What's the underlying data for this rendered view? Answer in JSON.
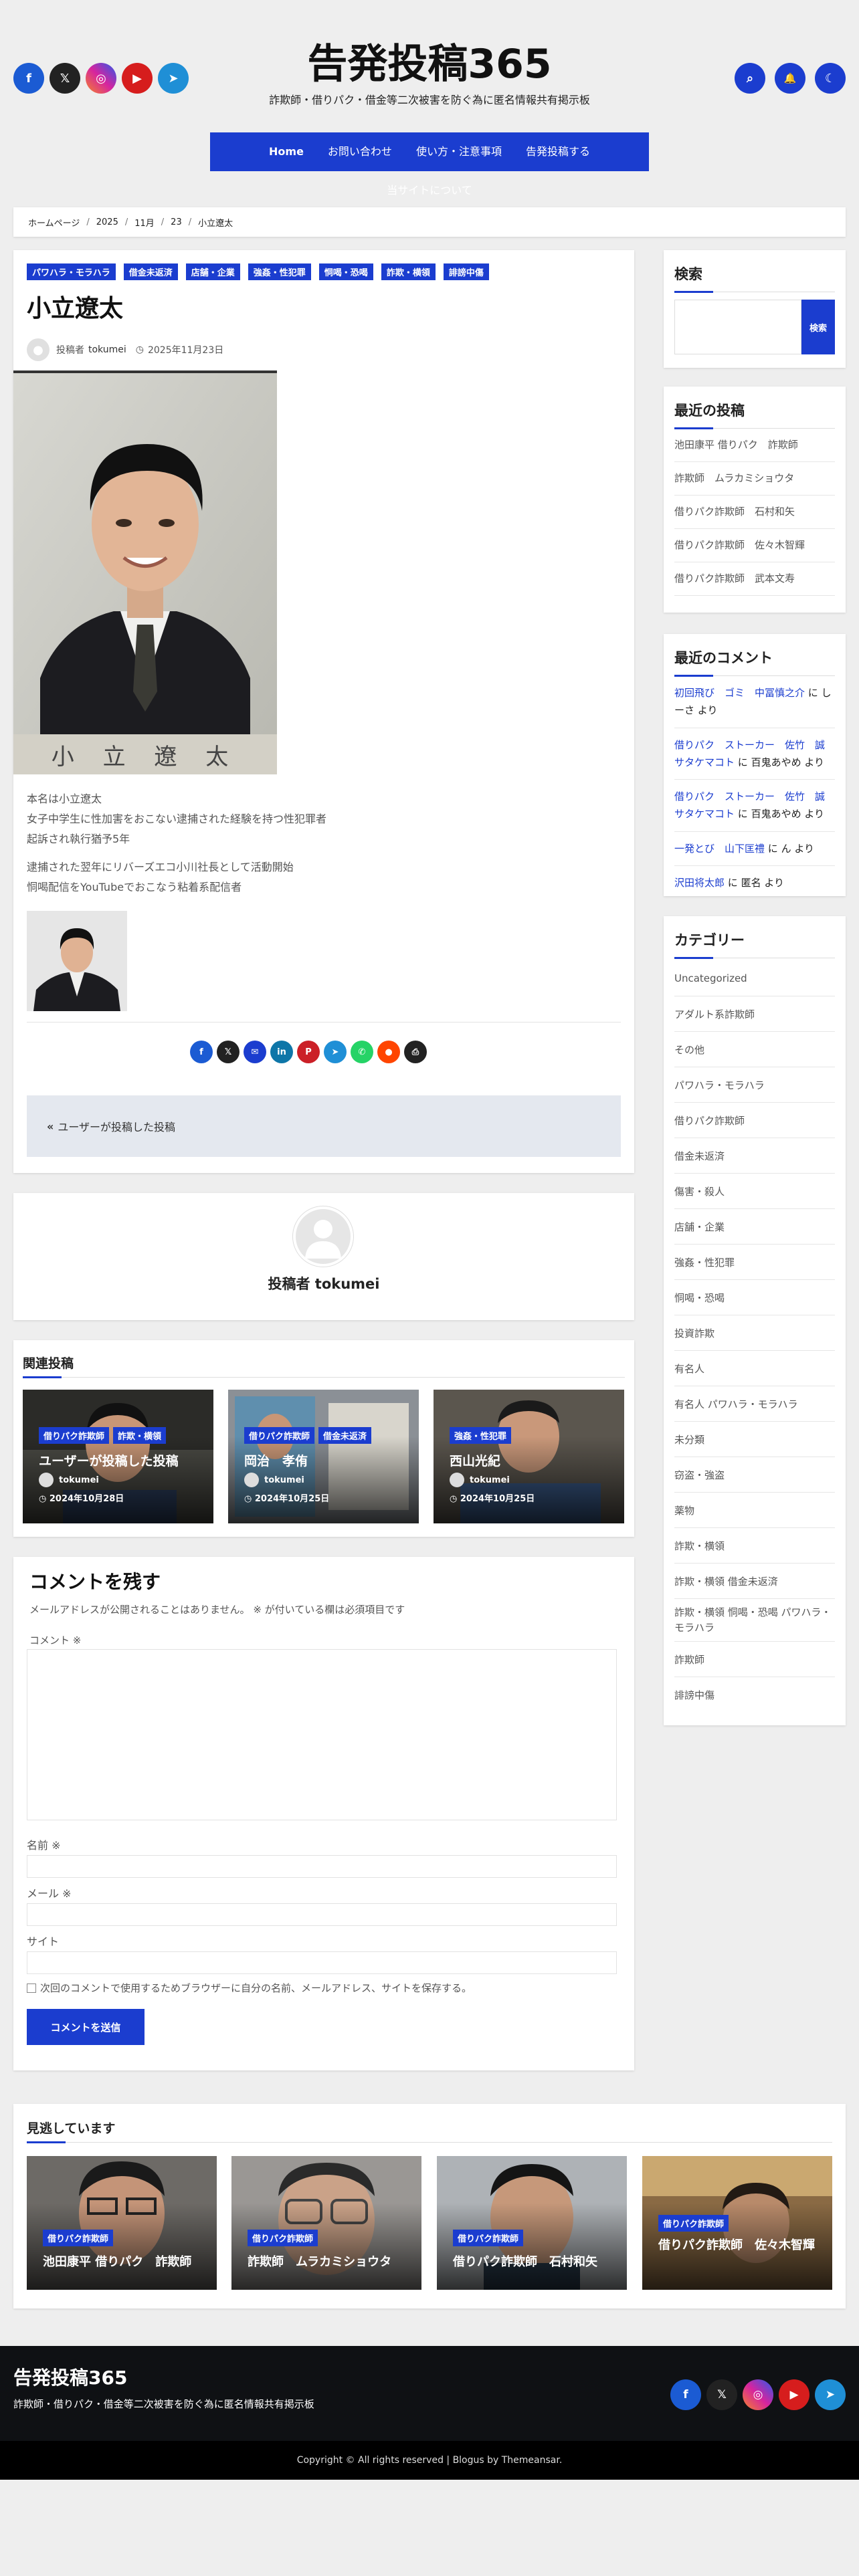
{
  "site": {
    "title": "告発投稿365",
    "tagline": "詐欺師・借りパク・借金等二次被害を防ぐ為に匿名情報共有掲示板"
  },
  "colors": {
    "accent": "#1b3dcf",
    "footer_bg": "#0f1114",
    "footer_bottom_bg": "#000000"
  },
  "header": {
    "social": [
      {
        "icon": "facebook-icon",
        "glyph": "f",
        "color": "#1b5bd3"
      },
      {
        "icon": "x-icon",
        "glyph": "𝕏",
        "color": "#222222"
      },
      {
        "icon": "instagram-icon",
        "glyph": "◎",
        "color": "#d6249f"
      },
      {
        "icon": "youtube-icon",
        "glyph": "▶",
        "color": "#d61d1d"
      },
      {
        "icon": "telegram-icon",
        "glyph": "➤",
        "color": "#1f8fd6"
      }
    ],
    "actions": [
      {
        "icon": "search-icon",
        "glyph": "⌕"
      },
      {
        "icon": "bell-icon",
        "glyph": "🔔"
      },
      {
        "icon": "dark-mode-icon",
        "glyph": "☾"
      }
    ]
  },
  "nav": [
    "Home",
    "お問い合わせ",
    "使い方・注意事項",
    "告発投稿する",
    "当サイトについて"
  ],
  "breadcrumb": [
    "ホームページ",
    "2025",
    "11月",
    "23",
    "小立遼太"
  ],
  "post": {
    "tags": [
      "パワハラ・モラハラ",
      "借金未返済",
      "店舗・企業",
      "強姦・性犯罪",
      "恫喝・恐喝",
      "詐欺・横領",
      "誹謗中傷"
    ],
    "title": "小立遼太",
    "author_prefix": "投稿者",
    "author": "tokumei",
    "date": "2025年11月23日",
    "photo_caption": "小 立 遼 太",
    "para1": [
      "本名は小立遼太",
      "女子中学生に性加害をおこない逮捕された経験を持つ性犯罪者",
      "起訴され執行猶予5年"
    ],
    "para2": [
      "逮捕された翌年にリバーズエコ小川社長として活動開始",
      "恫喝配信をYouTubeでおこなう粘着系配信者"
    ],
    "share": [
      {
        "icon": "facebook-share-icon",
        "glyph": "f",
        "color": "#1b5bd3"
      },
      {
        "icon": "x-share-icon",
        "glyph": "𝕏",
        "color": "#222222"
      },
      {
        "icon": "email-share-icon",
        "glyph": "✉",
        "color": "#1b3dcf"
      },
      {
        "icon": "linkedin-share-icon",
        "glyph": "in",
        "color": "#0e76a8"
      },
      {
        "icon": "pinterest-share-icon",
        "glyph": "P",
        "color": "#cb2027"
      },
      {
        "icon": "telegram-share-icon",
        "glyph": "➤",
        "color": "#1f8fd6"
      },
      {
        "icon": "whatsapp-share-icon",
        "glyph": "✆",
        "color": "#25d366"
      },
      {
        "icon": "reddit-share-icon",
        "glyph": "●",
        "color": "#ff4500"
      },
      {
        "icon": "print-icon",
        "glyph": "⎙",
        "color": "#222222"
      }
    ],
    "prev_post": "ユーザーが投稿した投稿"
  },
  "author_box": {
    "label": "投稿者",
    "name": "tokumei"
  },
  "related": {
    "title": "関連投稿",
    "items": [
      {
        "tags": [
          "借りパク詐欺師",
          "詐欺・横領"
        ],
        "title": "ユーザーが投稿した投稿",
        "author": "tokumei",
        "date": "2024年10月28日"
      },
      {
        "tags": [
          "借りパク詐欺師",
          "借金未返済"
        ],
        "title": "岡治　孝侑",
        "author": "tokumei",
        "date": "2024年10月25日"
      },
      {
        "tags": [
          "強姦・性犯罪"
        ],
        "title": "西山光紀",
        "author": "tokumei",
        "date": "2024年10月25日"
      }
    ]
  },
  "comment_form": {
    "title": "コメントを残す",
    "note": "メールアドレスが公開されることはありません。 ※ が付いている欄は必須項目です",
    "comment_label": "コメント ※",
    "name_label": "名前 ※",
    "email_label": "メール ※",
    "site_label": "サイト",
    "save_text": "次回のコメントで使用するためブラウザーに自分の名前、メールアドレス、サイトを保存する。",
    "submit": "コメントを送信"
  },
  "sidebar": {
    "search": {
      "title": "検索",
      "button": "検索"
    },
    "recent_posts": {
      "title": "最近の投稿",
      "items": [
        "池田康平 借りパク　詐欺師",
        "詐欺師　ムラカミショウタ",
        "借りパク詐欺師　石村和矢",
        "借りパク詐欺師　佐々木智輝",
        "借りパク詐欺師　武本文寿"
      ]
    },
    "recent_comments": {
      "title": "最近のコメント",
      "items": [
        {
          "link": "初回飛び　ゴミ　中冨慎之介",
          "mid": " に ",
          "author": "しーさ",
          "suffix": " より"
        },
        {
          "link": "借りパク　ストーカー　佐竹　誠 サタケマコト",
          "mid": " に ",
          "author": "百鬼あやめ",
          "suffix": " より"
        },
        {
          "link": "借りパク　ストーカー　佐竹　誠 サタケマコト",
          "mid": " に ",
          "author": "百鬼あやめ",
          "suffix": " より"
        },
        {
          "link": "一発とび　山下匡禮",
          "mid": " に ",
          "author": "ん",
          "suffix": " より"
        },
        {
          "link": "沢田将太郎",
          "mid": " に ",
          "author": "匿名",
          "suffix": " より"
        }
      ]
    },
    "categories": {
      "title": "カテゴリー",
      "items": [
        "Uncategorized",
        "アダルト系詐欺師",
        "その他",
        "パワハラ・モラハラ",
        "借りパク詐欺師",
        "借金未返済",
        "傷害・殺人",
        "店舗・企業",
        "強姦・性犯罪",
        "恫喝・恐喝",
        "投資詐欺",
        "有名人",
        "有名人 パワハラ・モラハラ",
        "未分類",
        "窃盗・強盗",
        "薬物",
        "詐欺・横領",
        "詐欺・横領 借金未返済",
        "詐欺・横領 恫喝・恐喝 パワハラ・モラハラ",
        "詐欺師",
        "誹謗中傷"
      ]
    }
  },
  "missed": {
    "title": "見逃しています",
    "items": [
      {
        "tag": "借りパク詐欺師",
        "title": "池田康平 借りパク　詐欺師"
      },
      {
        "tag": "借りパク詐欺師",
        "title": "詐欺師　ムラカミショウタ"
      },
      {
        "tag": "借りパク詐欺師",
        "title": "借りパク詐欺師　石村和矢"
      },
      {
        "tag": "借りパク詐欺師",
        "title": "借りパク詐欺師　佐々木智輝"
      }
    ]
  },
  "footer": {
    "title": "告発投稿365",
    "tagline": "詐欺師・借りパク・借金等二次被害を防ぐ為に匿名情報共有掲示板",
    "copyright": "Copyright © All rights reserved | Blogus by Themeansar."
  }
}
